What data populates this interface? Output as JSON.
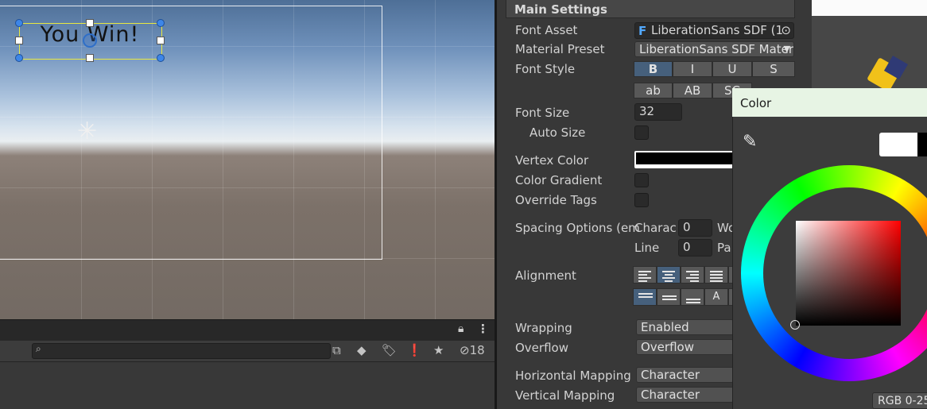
{
  "scene": {
    "ui_text": "You Win!"
  },
  "project_bar": {
    "search_placeholder": "",
    "hidden_count": "18"
  },
  "inspector": {
    "section_title": "Main Settings",
    "font_asset": {
      "label": "Font Asset",
      "value": "LiberationSans SDF (1"
    },
    "material_preset": {
      "label": "Material Preset",
      "value": "LiberationSans SDF Materi"
    },
    "font_style": {
      "label": "Font Style",
      "row1": [
        "B",
        "I",
        "U",
        "S"
      ],
      "row2": [
        "ab",
        "AB",
        "SC"
      ]
    },
    "font_size": {
      "label": "Font Size",
      "value": "32"
    },
    "auto_size": {
      "label": "Auto Size"
    },
    "vertex_color": {
      "label": "Vertex Color",
      "color": "#000000"
    },
    "color_gradient": {
      "label": "Color Gradient"
    },
    "override_tags": {
      "label": "Override Tags"
    },
    "spacing": {
      "label": "Spacing Options (em",
      "character_label": "Charac",
      "character_value": "0",
      "word_label": "Wo",
      "line_label": "Line",
      "line_value": "0",
      "paragraph_label": "Pa"
    },
    "alignment": {
      "label": "Alignment"
    },
    "wrapping": {
      "label": "Wrapping",
      "value": "Enabled"
    },
    "overflow": {
      "label": "Overflow",
      "value": "Overflow"
    },
    "horizontal_mapping": {
      "label": "Horizontal Mapping",
      "value": "Character"
    },
    "vertical_mapping": {
      "label": "Vertical Mapping",
      "value": "Character"
    }
  },
  "color_picker": {
    "title": "Color",
    "current_color": "#ffffff",
    "previous_color": "#000000",
    "mode": "RGB 0-25"
  }
}
